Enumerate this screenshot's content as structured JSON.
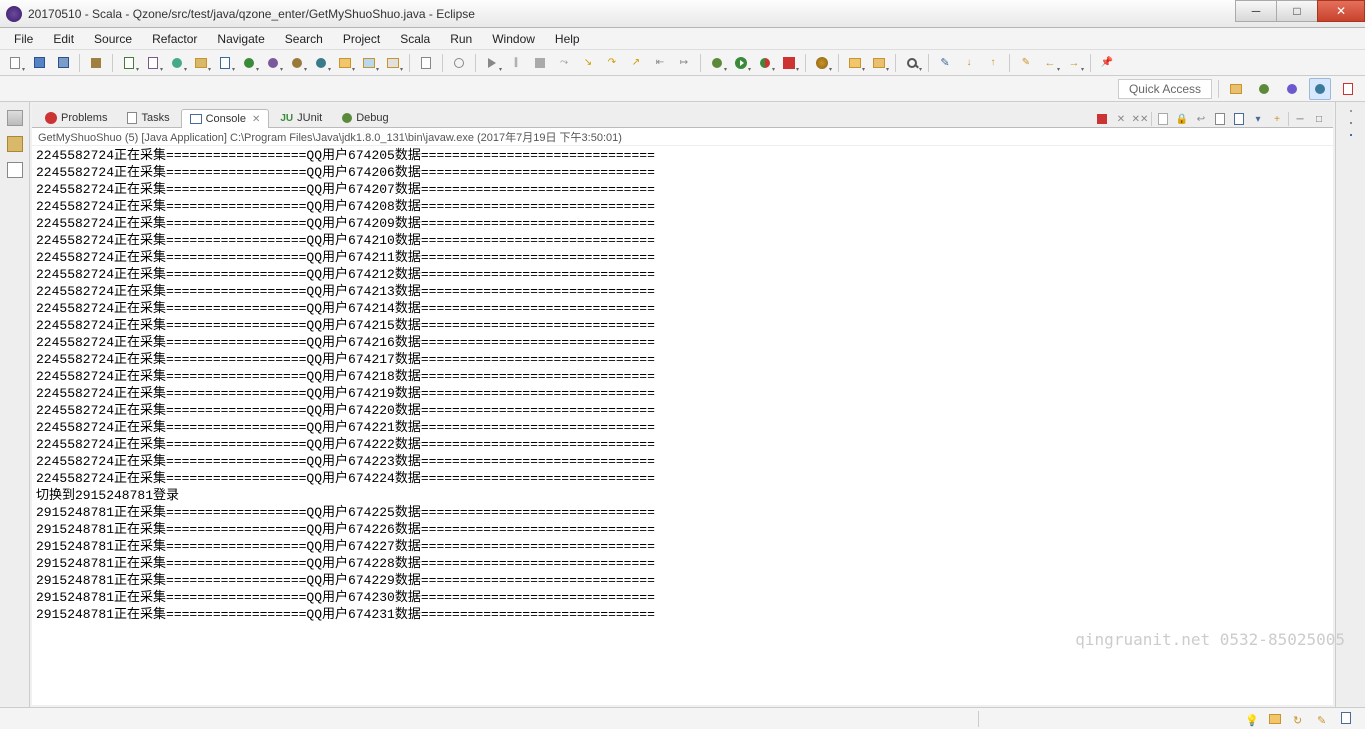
{
  "title": "20170510 - Scala - Qzone/src/test/java/qzone_enter/GetMyShuoShuo.java - Eclipse",
  "menus": [
    "File",
    "Edit",
    "Source",
    "Refactor",
    "Navigate",
    "Search",
    "Project",
    "Scala",
    "Run",
    "Window",
    "Help"
  ],
  "quick_access": "Quick Access",
  "views": {
    "problems": "Problems",
    "tasks": "Tasks",
    "console": "Console",
    "junit": "JUnit",
    "debug": "Debug"
  },
  "console": {
    "header": "GetMyShuoShuo (5) [Java Application] C:\\Program Files\\Java\\jdk1.8.0_131\\bin\\javaw.exe (2017年7月19日 下午3:50:01)",
    "switch_line": "切换到2915248781登录",
    "account_a": "2245582724",
    "account_b": "2915248781",
    "prefix": "正在采集",
    "mid": "QQ用户",
    "suffix": "数据",
    "range_a_start": 674205,
    "range_a_end": 674224,
    "range_b_start": 674225,
    "range_b_end": 674231
  },
  "watermark": "qingruanit.net 0532-85025005"
}
